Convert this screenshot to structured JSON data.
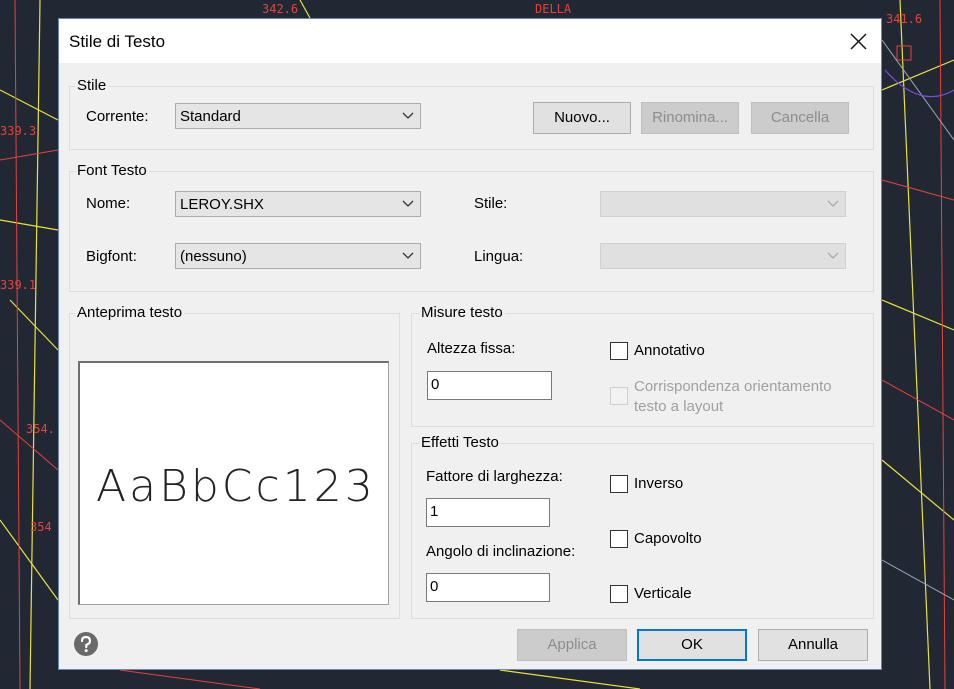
{
  "background": {
    "labels": [
      "342.6",
      "DELLA",
      "341.6",
      "339.3",
      "339.1",
      "354.",
      "354"
    ]
  },
  "dialog": {
    "title": "Stile di Testo",
    "style_group": {
      "legend": "Stile",
      "current_label": "Corrente:",
      "current_value": "Standard",
      "new_button": "Nuovo...",
      "rename_button": "Rinomina...",
      "delete_button": "Cancella"
    },
    "font_group": {
      "legend": "Font Testo",
      "name_label": "Nome:",
      "name_value": "LEROY.SHX",
      "bigfont_label": "Bigfont:",
      "bigfont_value": "(nessuno)",
      "style_label": "Stile:",
      "style_value": "",
      "language_label": "Lingua:",
      "language_value": ""
    },
    "preview_group": {
      "legend": "Anteprima testo",
      "sample": "AaBbCc123"
    },
    "size_group": {
      "legend": "Misure testo",
      "fixed_height_label": "Altezza fissa:",
      "fixed_height_value": "0",
      "annotative_label": "Annotativo",
      "annotative_checked": false,
      "match_orientation_line1": "Corrispondenza orientamento",
      "match_orientation_line2": "testo a layout",
      "match_orientation_enabled": false
    },
    "effects_group": {
      "legend": "Effetti Testo",
      "width_factor_label": "Fattore di larghezza:",
      "width_factor_value": "1",
      "oblique_angle_label": "Angolo di inclinazione:",
      "oblique_angle_value": "0",
      "backwards_label": "Inverso",
      "backwards_checked": false,
      "upside_down_label": "Capovolto",
      "upside_down_checked": false,
      "vertical_label": "Verticale",
      "vertical_checked": false
    },
    "footer": {
      "apply_button": "Applica",
      "ok_button": "OK",
      "cancel_button": "Annulla"
    }
  },
  "colors": {
    "cad_background": "#212833",
    "accent": "#0078d7",
    "dialog_bg": "#f0f0f0"
  }
}
